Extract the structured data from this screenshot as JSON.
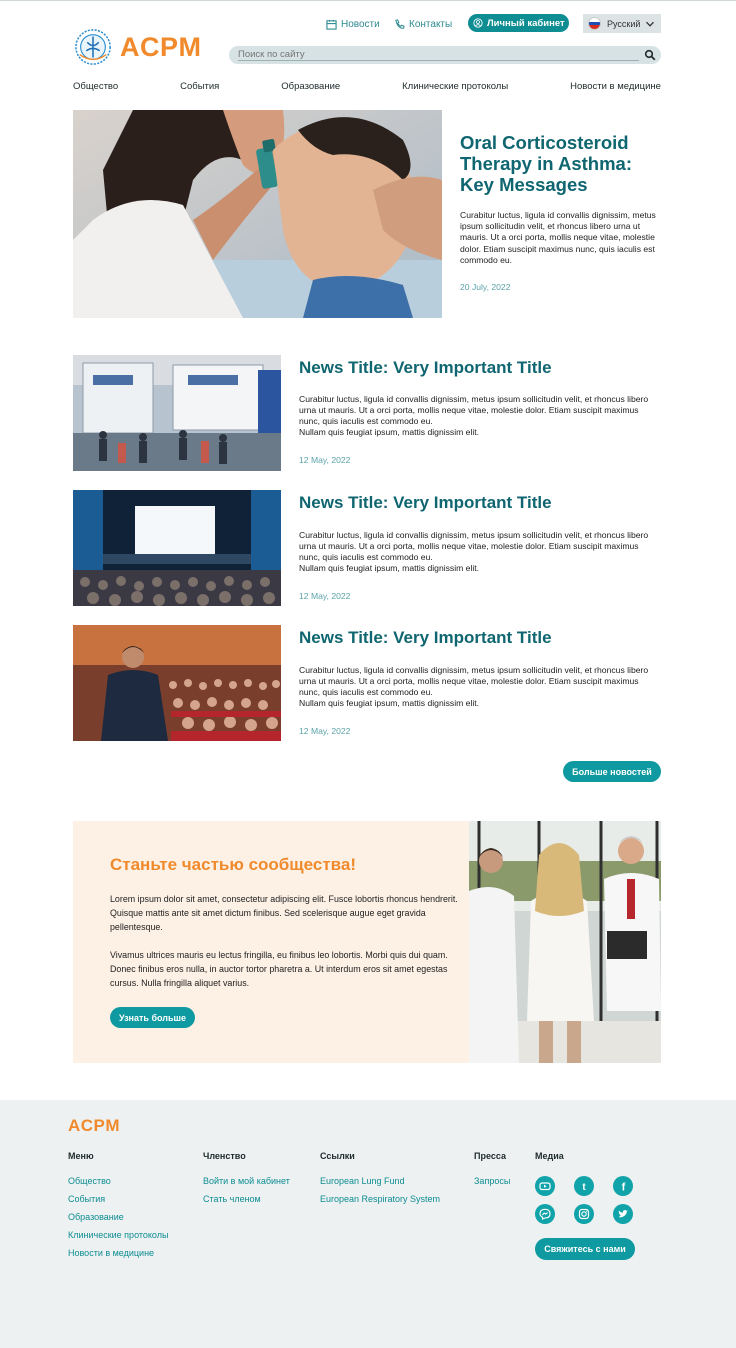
{
  "header": {
    "utility": {
      "news_label": "Новости",
      "contacts_label": "Контакты",
      "cabinet_label": "Личный кабинет",
      "language": "Русский"
    },
    "logo_text": "ACPM",
    "search": {
      "placeholder": "Поиск по сайту"
    },
    "nav": [
      "Общество",
      "События",
      "Образование",
      "Клинические протоколы",
      "Новости в медицине"
    ]
  },
  "hero": {
    "title": "Oral Corticosteroid Therapy in Asthma: Key Messages",
    "text": "Curabitur luctus, ligula id convallis dignissim, metus ipsum sollicitudin velit, et rhoncus libero urna ut mauris. Ut a orci porta, mollis neque vitae, molestie dolor. Etiam suscipit maximus nunc, quis iaculis est commodo eu.",
    "date": "20 July, 2022"
  },
  "news": [
    {
      "title": "News Title: Very Important Title",
      "text": "Curabitur luctus, ligula id convallis dignissim, metus ipsum sollicitudin velit, et rhoncus libero urna ut mauris. Ut a orci porta, mollis neque vitae, molestie dolor. Etiam suscipit maximus nunc, quis iaculis est commodo eu.",
      "text2": "Nullam quis feugiat ipsum, mattis dignissim elit.",
      "date": "12 May, 2022"
    },
    {
      "title": "News Title: Very Important Title",
      "text": "Curabitur luctus, ligula id convallis dignissim, metus ipsum sollicitudin velit, et rhoncus libero urna ut mauris. Ut a orci porta, mollis neque vitae, molestie dolor. Etiam suscipit maximus nunc, quis iaculis est commodo eu.",
      "text2": "Nullam quis feugiat ipsum, mattis dignissim elit.",
      "date": "12 May, 2022"
    },
    {
      "title": "News Title: Very Important Title",
      "text": "Curabitur luctus, ligula id convallis dignissim, metus ipsum sollicitudin velit, et rhoncus libero urna ut mauris. Ut a orci porta, mollis neque vitae, molestie dolor. Etiam suscipit maximus nunc, quis iaculis est commodo eu.",
      "text2": "Nullam quis feugiat ipsum, mattis dignissim elit.",
      "date": "12 May, 2022"
    }
  ],
  "more_news_label": "Больше новостей",
  "community": {
    "title": "Станьте частью сообщества!",
    "p1": "Lorem ipsum dolor sit amet, consectetur adipiscing elit. Fusce lobortis rhoncus hendrerit. Quisque mattis ante sit amet dictum finibus. Sed scelerisque augue eget gravida pellentesque.",
    "p2": "Vivamus ultrices mauris eu lectus fringilla, eu finibus leo lobortis. Morbi quis dui quam. Donec finibus eros nulla, in auctor tortor pharetra a. Ut interdum eros sit amet egestas cursus. Nulla fringilla aliquet varius.",
    "button_label": "Узнать больше"
  },
  "footer": {
    "logo_text": "ACPM",
    "menu": {
      "heading": "Меню",
      "items": [
        "Общество",
        "События",
        "Образование",
        "Клинические протоколы",
        "Новости в медицине"
      ]
    },
    "membership": {
      "heading": "Членство",
      "items": [
        "Войти в мой кабинет",
        "Стать членом"
      ]
    },
    "links": {
      "heading": "Ссылки",
      "items": [
        "European Lung Fund",
        "European Respiratory System"
      ]
    },
    "press": {
      "heading": "Пресса",
      "items": [
        "Запросы"
      ]
    },
    "media": {
      "heading": "Медиа",
      "icons": [
        "youtube-icon",
        "tumblr-icon",
        "facebook-icon",
        "messenger-icon",
        "instagram-icon",
        "twitter-icon"
      ]
    },
    "contact_label": "Свяжитесь с нами"
  },
  "colors": {
    "teal": "#0e9aa0",
    "dark_teal": "#0f6670",
    "orange": "#f08a2c",
    "cream": "#fdf1e6",
    "footer_bg": "#edf1f1"
  }
}
